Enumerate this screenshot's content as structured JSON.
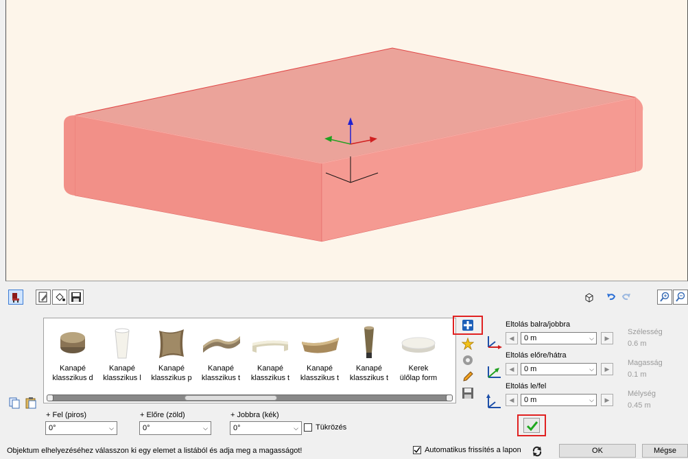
{
  "viewport": {
    "object_color": "#f47f7f",
    "background": "#fdf5ea"
  },
  "toolbar": {
    "left_icons": [
      "furniture-icon",
      "edit-sheet-icon",
      "paint-bucket-icon",
      "save-icon"
    ],
    "right_icons": [
      "cube-view-icon",
      "undo-icon",
      "redo-icon",
      "zoom-in-icon",
      "zoom-out-icon"
    ]
  },
  "catalog": {
    "items": [
      {
        "line1": "Kanapé",
        "line2": "klasszikus d",
        "shape": "ottoman"
      },
      {
        "line1": "Kanapé",
        "line2": "klasszikus l",
        "shape": "leg"
      },
      {
        "line1": "Kanapé",
        "line2": "klasszikus p",
        "shape": "pillow"
      },
      {
        "line1": "Kanapé",
        "line2": "klasszikus t",
        "shape": "backrest"
      },
      {
        "line1": "Kanapé",
        "line2": "klasszikus t",
        "shape": "armrest"
      },
      {
        "line1": "Kanapé",
        "line2": "klasszikus t",
        "shape": "basket"
      },
      {
        "line1": "Kanapé",
        "line2": "klasszikus t",
        "shape": "tall-leg"
      },
      {
        "line1": "Kerek",
        "line2": "ülőlap form",
        "shape": "disc"
      }
    ]
  },
  "side_tools": [
    "add-icon",
    "favorite-star-icon",
    "settings-gear-icon",
    "pencil-icon",
    "save-icon"
  ],
  "offsets": {
    "x_label": "Eltolás balra/jobbra",
    "x_value": "0 m",
    "y_label": "Eltolás előre/hátra",
    "y_value": "0 m",
    "z_label": "Eltolás le/fel",
    "z_value": "0 m"
  },
  "dimensions": {
    "width_label": "Szélesség",
    "width_value": "0.6 m",
    "height_label": "Magasság",
    "height_value": "0.1 m",
    "depth_label": "Mélység",
    "depth_value": "0.45 m"
  },
  "rotation": {
    "up_label": "+ Fel (piros)",
    "up_value": "0°",
    "forward_label": "+ Előre (zöld)",
    "forward_value": "0°",
    "right_label": "+ Jobbra (kék)",
    "right_value": "0°",
    "mirror_label": "Tükrözés"
  },
  "status": {
    "hint": "Objektum elhelyezéséhez válasszon ki egy elemet a listából és adja meg a magasságot!",
    "auto_refresh_label": "Automatikus frissítés a lapon",
    "auto_refresh_checked": true,
    "ok_label": "OK",
    "cancel_label": "Mégse"
  }
}
